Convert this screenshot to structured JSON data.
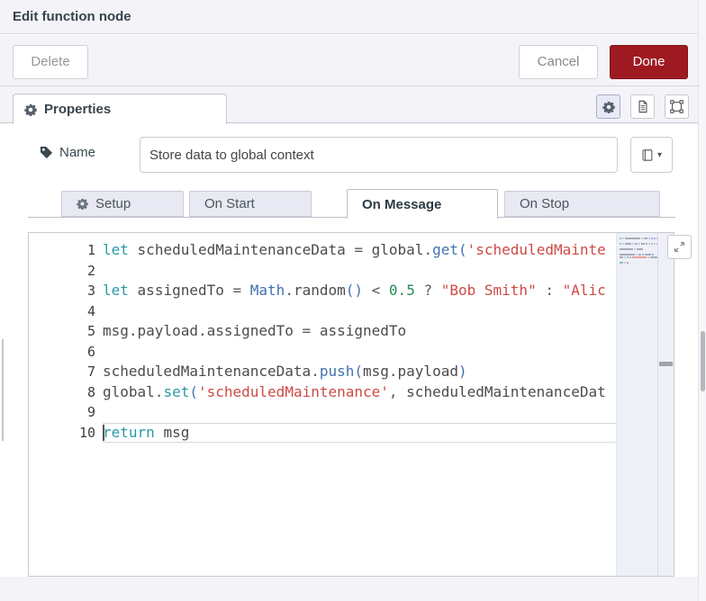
{
  "dialog": {
    "title": "Edit function node"
  },
  "toolbar": {
    "delete_label": "Delete",
    "cancel_label": "Cancel",
    "done_label": "Done"
  },
  "properties_tab": {
    "label": "Properties",
    "icon": "gear-icon"
  },
  "header_icon_buttons": [
    {
      "icon": "gear-icon",
      "active": true
    },
    {
      "icon": "doc-icon",
      "active": false
    },
    {
      "icon": "frame-icon",
      "active": false
    }
  ],
  "name_field": {
    "label": "Name",
    "icon": "tag-icon",
    "value": "Store data to global context"
  },
  "name_field_library_button": {
    "icon": "book-icon",
    "caret": "▾"
  },
  "editor_tabs": [
    {
      "label": "Setup",
      "icon": "gear-icon",
      "active": false
    },
    {
      "label": "On Start",
      "active": false
    },
    {
      "label": "On Message",
      "active": true
    },
    {
      "label": "On Stop",
      "active": false
    }
  ],
  "colors": {
    "done_button": "#9e1a20",
    "keyword": "#2899a6",
    "function_call": "#4271ae",
    "string": "#cc4a44",
    "number": "#258d52",
    "identifier": "#4b4b4b"
  },
  "code": {
    "language": "javascript",
    "current_line": 10,
    "lines": [
      {
        "num": 1,
        "tokens": [
          {
            "c": "kw",
            "t": "let"
          },
          {
            "c": "op",
            "t": " "
          },
          {
            "c": "id",
            "t": "scheduledMaintenanceData"
          },
          {
            "c": "op",
            "t": " = "
          },
          {
            "c": "id",
            "t": "global"
          },
          {
            "c": "op",
            "t": "."
          },
          {
            "c": "fn",
            "t": "get"
          },
          {
            "c": "fn",
            "t": "("
          },
          {
            "c": "str",
            "t": "'scheduledMainte"
          }
        ]
      },
      {
        "num": 2,
        "tokens": []
      },
      {
        "num": 3,
        "tokens": [
          {
            "c": "kw",
            "t": "let"
          },
          {
            "c": "op",
            "t": " "
          },
          {
            "c": "id",
            "t": "assignedTo"
          },
          {
            "c": "op",
            "t": " = "
          },
          {
            "c": "fn",
            "t": "Math"
          },
          {
            "c": "op",
            "t": "."
          },
          {
            "c": "id",
            "t": "random"
          },
          {
            "c": "fn",
            "t": "()"
          },
          {
            "c": "op",
            "t": " < "
          },
          {
            "c": "num",
            "t": "0.5"
          },
          {
            "c": "op",
            "t": " ? "
          },
          {
            "c": "str",
            "t": "\"Bob Smith\""
          },
          {
            "c": "op",
            "t": " : "
          },
          {
            "c": "str",
            "t": "\"Alic"
          }
        ]
      },
      {
        "num": 4,
        "tokens": []
      },
      {
        "num": 5,
        "tokens": [
          {
            "c": "id",
            "t": "msg.payload.assignedTo"
          },
          {
            "c": "op",
            "t": " = "
          },
          {
            "c": "id",
            "t": "assignedTo"
          }
        ]
      },
      {
        "num": 6,
        "tokens": []
      },
      {
        "num": 7,
        "tokens": [
          {
            "c": "id",
            "t": "scheduledMaintenanceData"
          },
          {
            "c": "op",
            "t": "."
          },
          {
            "c": "fn",
            "t": "push"
          },
          {
            "c": "fn",
            "t": "("
          },
          {
            "c": "id",
            "t": "msg.payload"
          },
          {
            "c": "fn",
            "t": ")"
          }
        ]
      },
      {
        "num": 8,
        "tokens": [
          {
            "c": "id",
            "t": "global"
          },
          {
            "c": "op",
            "t": "."
          },
          {
            "c": "kw",
            "t": "set"
          },
          {
            "c": "fn",
            "t": "("
          },
          {
            "c": "str",
            "t": "'scheduledMaintenance'"
          },
          {
            "c": "op",
            "t": ", "
          },
          {
            "c": "id",
            "t": "scheduledMaintenanceDat"
          }
        ]
      },
      {
        "num": 9,
        "tokens": []
      },
      {
        "num": 10,
        "tokens": [
          {
            "c": "kw",
            "t": "return"
          },
          {
            "c": "op",
            "t": " "
          },
          {
            "c": "id",
            "t": "msg"
          }
        ]
      }
    ]
  }
}
